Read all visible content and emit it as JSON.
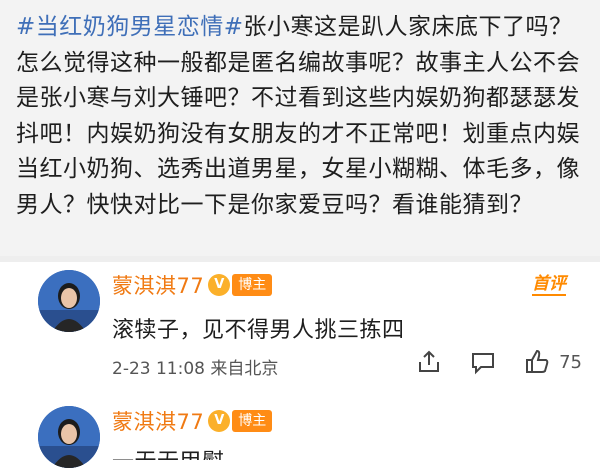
{
  "post": {
    "hashtag": "#当红奶狗男星恋情#",
    "body": "张小寒这是趴人家床底下了吗？怎么觉得这种一般都是匿名编故事呢？故事主人公不会是张小寒与刘大锤吧？不过看到这些内娱奶狗都瑟瑟发抖吧！内娱奶狗没有女朋友的才不正常吧！划重点内娱当红小奶狗、选秀出道男星，女星小糊糊、体毛多，像男人？快快对比一下是你家爱豆吗？看谁能猜到？"
  },
  "comments": [
    {
      "user": "蒙淇淇77",
      "vip_icon": "V",
      "badge": "博主",
      "first_badge": "首评",
      "text": "滚犊子，见不得男人挑三拣四",
      "time": "2-23 11:08",
      "source": "来自北京",
      "likes": "75"
    },
    {
      "user": "蒙淇淇77",
      "vip_icon": "V",
      "badge": "博主",
      "text": "一无无甲熨"
    }
  ],
  "icons": {
    "share": "share-icon",
    "comment": "comment-icon",
    "like": "thumbs-up-icon"
  },
  "colors": {
    "hashtag": "#3f6fb8",
    "username": "#f07a13",
    "badge": "#ff8c15",
    "post_bg": "#f3f3f3"
  }
}
